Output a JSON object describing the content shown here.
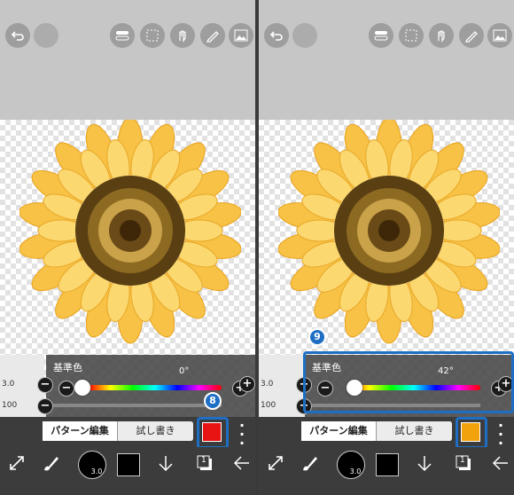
{
  "left": {
    "hue_label": "基準色",
    "hue_value": "0°",
    "brush_size": "3.0",
    "opacity": "100",
    "tab_pattern": "パターン編集",
    "tab_trial": "試し書き",
    "swatch_color": "#e81313",
    "badge": "8",
    "brush_readout": "3.0",
    "layer_count": "1"
  },
  "right": {
    "hue_label": "基準色",
    "hue_value": "42°",
    "brush_size": "3.0",
    "opacity": "100",
    "tab_pattern": "パターン編集",
    "tab_trial": "試し書き",
    "swatch_color": "#f2a20c",
    "badge": "9",
    "brush_readout": "3.0",
    "layer_count": "1"
  },
  "colors": {
    "highlight": "#1e6fc4",
    "bar": "#3c3c3c"
  }
}
